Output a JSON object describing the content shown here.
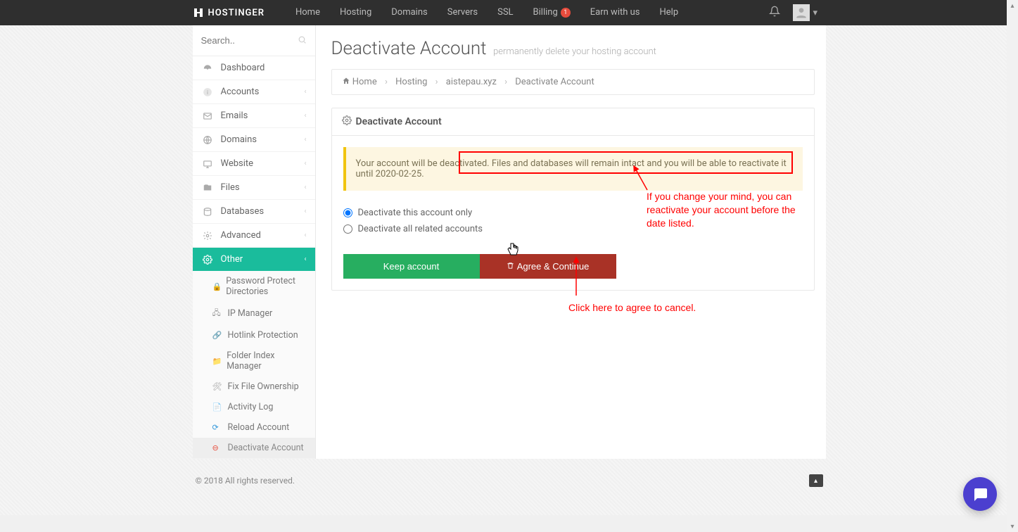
{
  "brand": "HOSTINGER",
  "nav": {
    "home": "Home",
    "hosting": "Hosting",
    "domains": "Domains",
    "servers": "Servers",
    "ssl": "SSL",
    "billing": "Billing",
    "billing_badge": "1",
    "earn": "Earn with us",
    "help": "Help"
  },
  "search": {
    "placeholder": "Search.."
  },
  "sidebar": {
    "items": [
      {
        "label": "Dashboard"
      },
      {
        "label": "Accounts"
      },
      {
        "label": "Emails"
      },
      {
        "label": "Domains"
      },
      {
        "label": "Website"
      },
      {
        "label": "Files"
      },
      {
        "label": "Databases"
      },
      {
        "label": "Advanced"
      },
      {
        "label": "Other"
      }
    ],
    "other_sub": [
      {
        "label": "Password Protect Directories"
      },
      {
        "label": "IP Manager"
      },
      {
        "label": "Hotlink Protection"
      },
      {
        "label": "Folder Index Manager"
      },
      {
        "label": "Fix File Ownership"
      },
      {
        "label": "Activity Log"
      },
      {
        "label": "Reload Account"
      },
      {
        "label": "Deactivate Account"
      }
    ]
  },
  "page": {
    "title": "Deactivate Account",
    "subtitle": "permanently delete your hosting account"
  },
  "breadcrumb": {
    "home": "Home",
    "hosting": "Hosting",
    "domain": "aistepau.xyz",
    "current": "Deactivate Account"
  },
  "panel": {
    "header": "Deactivate Account",
    "alert": "Your account will be deactivated. Files and databases will remain intact and you will be able to reactivate it until 2020-02-25.",
    "opt1": "Deactivate this account only",
    "opt2": "Deactivate all related accounts",
    "btn_keep": "Keep account",
    "btn_agree": "Agree & Continue"
  },
  "annotations": {
    "a1": "If you change your mind, you can reactivate your account before the date listed.",
    "a2": "Click here to agree to cancel."
  },
  "footer": {
    "copyright": "© 2018 All rights reserved."
  }
}
